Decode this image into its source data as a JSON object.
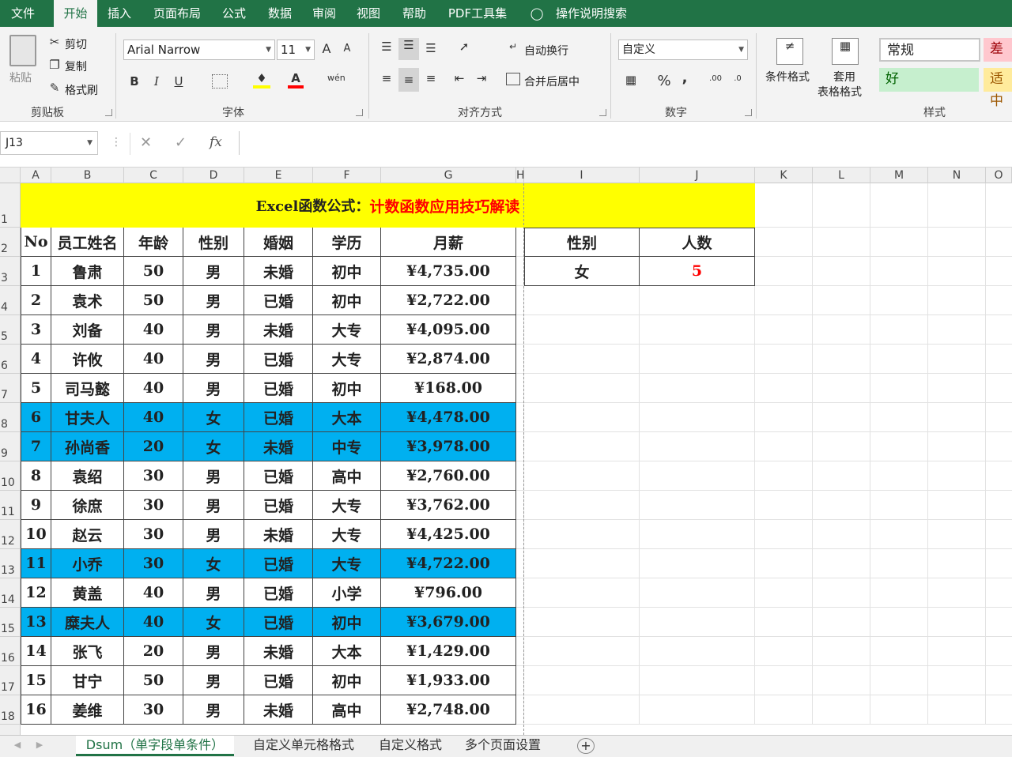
{
  "tabs": [
    "文件",
    "开始",
    "插入",
    "页面布局",
    "公式",
    "数据",
    "审阅",
    "视图",
    "帮助",
    "PDF工具集",
    "操作说明搜索"
  ],
  "ribbon": {
    "clipboard": {
      "paste": "粘贴",
      "cut": "剪切",
      "copy": "复制",
      "format_painter": "格式刷",
      "label": "剪贴板"
    },
    "font": {
      "name": "Arial Narrow",
      "size": "11",
      "bold": "B",
      "italic": "I",
      "underline": "U",
      "label": "字体",
      "grow": "A",
      "shrink": "A",
      "color": "A",
      "phonetic": "wén"
    },
    "alignment": {
      "wrap": "自动换行",
      "merge": "合并后居中",
      "label": "对齐方式"
    },
    "number": {
      "format": "自定义",
      "label": "数字",
      "percent": "%",
      "comma": ","
    },
    "styles": {
      "conditional": "条件格式",
      "table_format_1": "套用",
      "table_format_2": "表格格式",
      "normal": "常规",
      "bad": "差",
      "good": "好",
      "neutral": "适中",
      "label": "样式"
    }
  },
  "formula_bar": {
    "name_box": "J13",
    "fx": "fx",
    "content": ""
  },
  "columns": [
    "A",
    "B",
    "C",
    "D",
    "E",
    "F",
    "G",
    "H",
    "I",
    "J",
    "K",
    "L",
    "M",
    "N",
    "O"
  ],
  "rows": [
    "1",
    "2",
    "3",
    "4",
    "5",
    "6",
    "7",
    "8",
    "9",
    "10",
    "11",
    "12",
    "13",
    "14",
    "15",
    "16",
    "17",
    "18"
  ],
  "title": {
    "black": "Excel函数公式：",
    "red": "计数函数应用技巧解读"
  },
  "headers": [
    "No",
    "员工姓名",
    "年龄",
    "性别",
    "婚姻",
    "学历",
    "月薪"
  ],
  "table": [
    [
      "1",
      "鲁肃",
      "50",
      "男",
      "未婚",
      "初中",
      "¥4,735.00"
    ],
    [
      "2",
      "袁术",
      "50",
      "男",
      "已婚",
      "初中",
      "¥2,722.00"
    ],
    [
      "3",
      "刘备",
      "40",
      "男",
      "未婚",
      "大专",
      "¥4,095.00"
    ],
    [
      "4",
      "许攸",
      "40",
      "男",
      "已婚",
      "大专",
      "¥2,874.00"
    ],
    [
      "5",
      "司马懿",
      "40",
      "男",
      "已婚",
      "初中",
      "¥168.00"
    ],
    [
      "6",
      "甘夫人",
      "40",
      "女",
      "已婚",
      "大本",
      "¥4,478.00"
    ],
    [
      "7",
      "孙尚香",
      "20",
      "女",
      "未婚",
      "中专",
      "¥3,978.00"
    ],
    [
      "8",
      "袁绍",
      "30",
      "男",
      "已婚",
      "高中",
      "¥2,760.00"
    ],
    [
      "9",
      "徐庶",
      "30",
      "男",
      "已婚",
      "大专",
      "¥3,762.00"
    ],
    [
      "10",
      "赵云",
      "30",
      "男",
      "未婚",
      "大专",
      "¥4,425.00"
    ],
    [
      "11",
      "小乔",
      "30",
      "女",
      "已婚",
      "大专",
      "¥4,722.00"
    ],
    [
      "12",
      "黄盖",
      "40",
      "男",
      "已婚",
      "小学",
      "¥796.00"
    ],
    [
      "13",
      "糜夫人",
      "40",
      "女",
      "已婚",
      "初中",
      "¥3,679.00"
    ],
    [
      "14",
      "张飞",
      "20",
      "男",
      "未婚",
      "大本",
      "¥1,429.00"
    ],
    [
      "15",
      "甘宁",
      "50",
      "男",
      "已婚",
      "初中",
      "¥1,933.00"
    ],
    [
      "16",
      "姜维",
      "30",
      "男",
      "未婚",
      "高中",
      "¥2,748.00"
    ]
  ],
  "highlight_rows": [
    5,
    6,
    10,
    12
  ],
  "side": {
    "h1": "性别",
    "h2": "人数",
    "v1": "女",
    "v2": "5"
  },
  "sheets": [
    "Dsum（单字段单条件）",
    "自定义单元格格式",
    "自定义格式",
    "多个页面设置"
  ],
  "colors": {
    "green": "#217346",
    "highlight": "#00b0f0",
    "title_bg": "#ffff00",
    "red": "#ff0000"
  }
}
